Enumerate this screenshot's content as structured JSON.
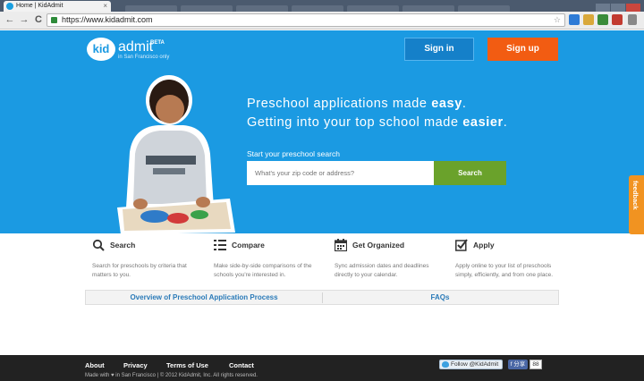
{
  "browser": {
    "tab_title": "Home | KidAdmit",
    "tab_close": "×",
    "url": "https://www.kidadmit.com",
    "back": "←",
    "forward": "→",
    "reload": "C",
    "star": "☆"
  },
  "header": {
    "logo_kid": "kid",
    "logo_word": "admit",
    "logo_beta": "BETA",
    "logo_sub": "in San Francisco only",
    "signin_label": "Sign in",
    "signup_label": "Sign up"
  },
  "hero": {
    "line1_pre": "Preschool applications made ",
    "line1_bold": "easy",
    "line1_post": ".",
    "line2_pre": "Getting into your top school made ",
    "line2_bold": "easier",
    "line2_post": ".",
    "search_label": "Start your preschool search",
    "search_placeholder": "What's your zip code or address?",
    "search_button": "Search"
  },
  "feedback_label": "feedback",
  "features": [
    {
      "title": "Search",
      "desc": "Search for preschools by criteria that matters to you.",
      "icon": "search-icon"
    },
    {
      "title": "Compare",
      "desc": "Make side-by-side comparisons of the schools you're interested in.",
      "icon": "list-icon"
    },
    {
      "title": "Get Organized",
      "desc": "Sync admission dates and deadlines directly to your calendar.",
      "icon": "calendar-icon"
    },
    {
      "title": "Apply",
      "desc": "Apply online to your list of preschools simply, efficiently, and from one place.",
      "icon": "checkbox-icon"
    }
  ],
  "links": {
    "overview": "Overview of Preschool Application Process",
    "faqs": "FAQs"
  },
  "footer": {
    "nav": [
      "About",
      "Privacy",
      "Terms of Use",
      "Contact"
    ],
    "copyright": "Made with ♥ in San Francisco | © 2012 KidAdmit, Inc. All rights reserved.",
    "twitter": "Follow @KidAdmit",
    "fb_share": "f 分享",
    "fb_count": "88"
  },
  "colors": {
    "hero_bg": "#1b9ae2",
    "signup": "#f25c12",
    "search_button": "#6aa22b",
    "feedback_tab": "#f19321"
  }
}
